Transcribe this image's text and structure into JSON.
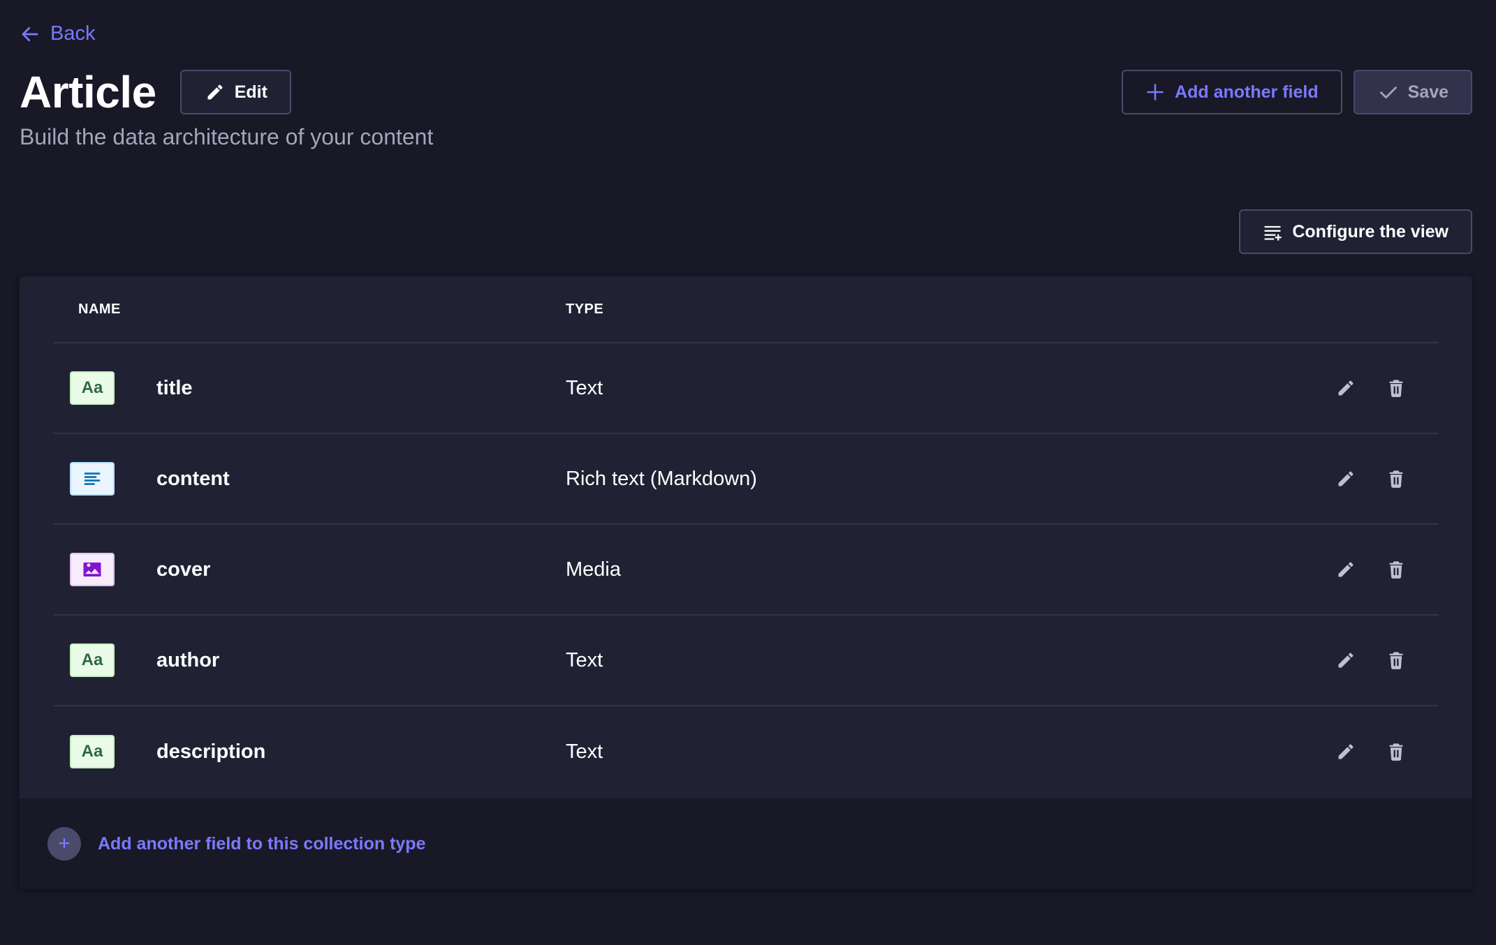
{
  "nav": {
    "back_label": "Back"
  },
  "header": {
    "title": "Article",
    "edit_label": "Edit",
    "subtitle": "Build the data architecture of your content",
    "add_field_label": "Add another field",
    "save_label": "Save"
  },
  "toolbar": {
    "configure_label": "Configure the view"
  },
  "table": {
    "columns": [
      "NAME",
      "TYPE"
    ],
    "rows": [
      {
        "name": "title",
        "type": "Text",
        "icon": "text-field-icon"
      },
      {
        "name": "content",
        "type": "Rich text (Markdown)",
        "icon": "rich-text-field-icon"
      },
      {
        "name": "cover",
        "type": "Media",
        "icon": "media-field-icon"
      },
      {
        "name": "author",
        "type": "Text",
        "icon": "text-field-icon"
      },
      {
        "name": "description",
        "type": "Text",
        "icon": "text-field-icon"
      }
    ],
    "text_icon_glyph": "Aa",
    "footer_label": "Add another field to this collection type",
    "footer_plus": "+"
  },
  "colors": {
    "background": "#181826",
    "surface": "#212134",
    "accent": "#7b79ff",
    "border": "#4a4a6a",
    "muted_text": "#a5a5ba"
  }
}
